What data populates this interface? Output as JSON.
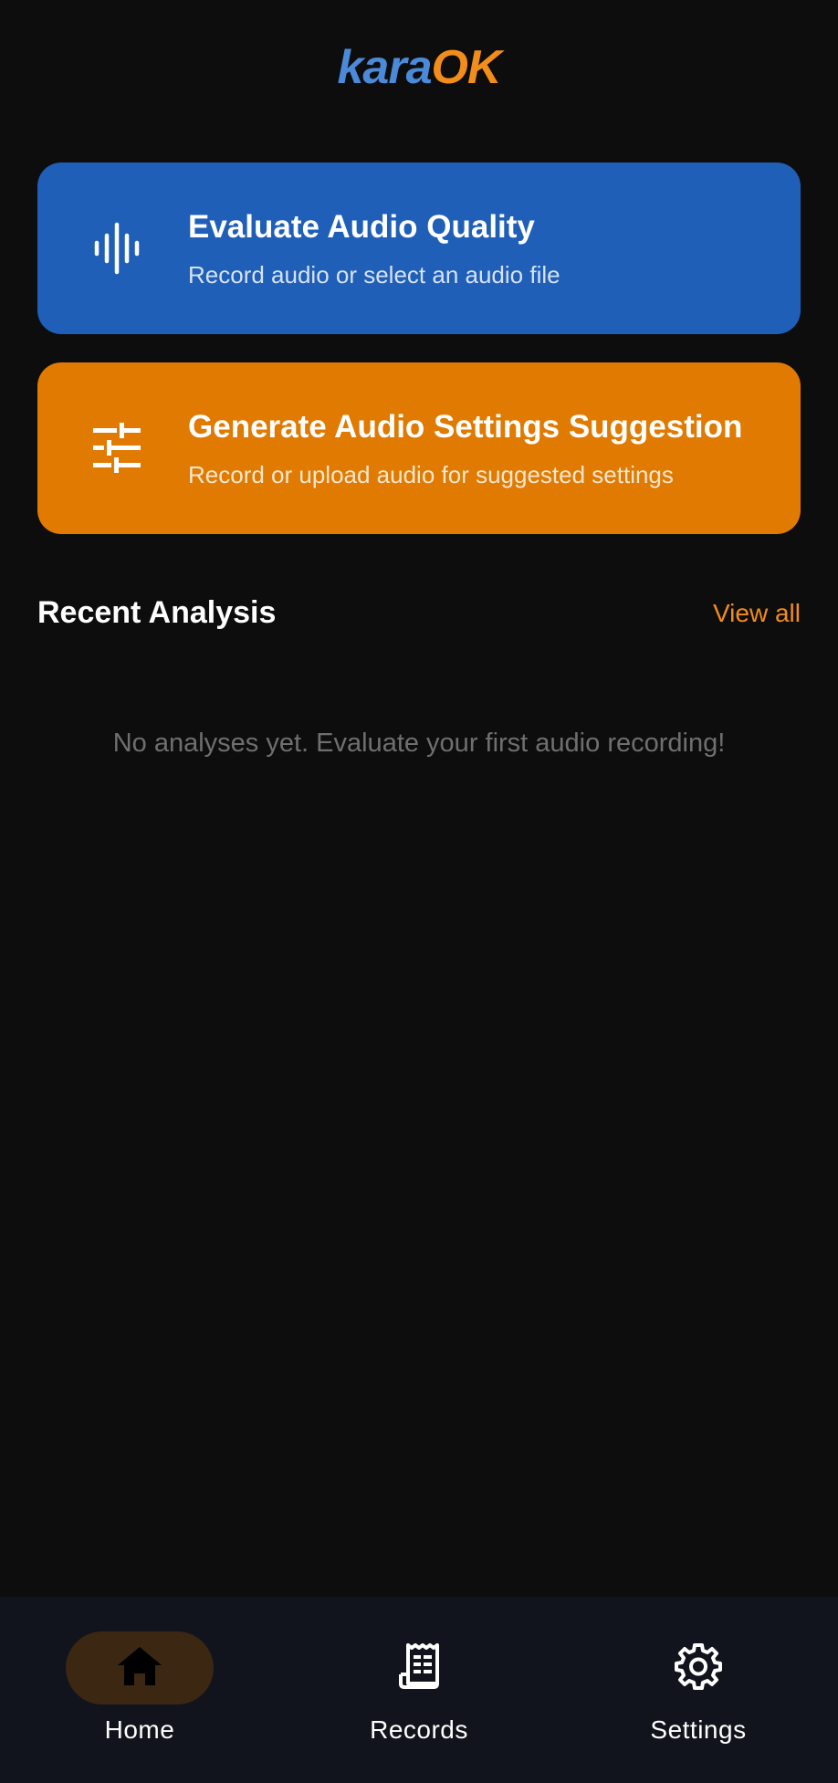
{
  "app": {
    "logo_part1": "kara",
    "logo_part2": "OK",
    "logo_colors": {
      "part1": "#4a8ad8",
      "part2": "#f28c1a"
    }
  },
  "actions": [
    {
      "title": "Evaluate Audio Quality",
      "subtitle": "Record audio or select an audio file",
      "icon": "waveform-icon",
      "color": "#1f5fb8"
    },
    {
      "title": "Generate Audio Settings Suggestion",
      "subtitle": "Record or upload audio for suggested settings",
      "icon": "sliders-icon",
      "color": "#e07a00"
    }
  ],
  "recent": {
    "title": "Recent Analysis",
    "view_all": "View all",
    "empty_message": "No analyses yet. Evaluate your first audio recording!"
  },
  "nav": {
    "items": [
      {
        "label": "Home",
        "icon": "home-icon",
        "active": true
      },
      {
        "label": "Records",
        "icon": "receipt-icon",
        "active": false
      },
      {
        "label": "Settings",
        "icon": "gear-icon",
        "active": false
      }
    ]
  },
  "colors": {
    "background": "#0d0d0d",
    "accent": "#f28c1a",
    "nav_background": "#11141c"
  }
}
